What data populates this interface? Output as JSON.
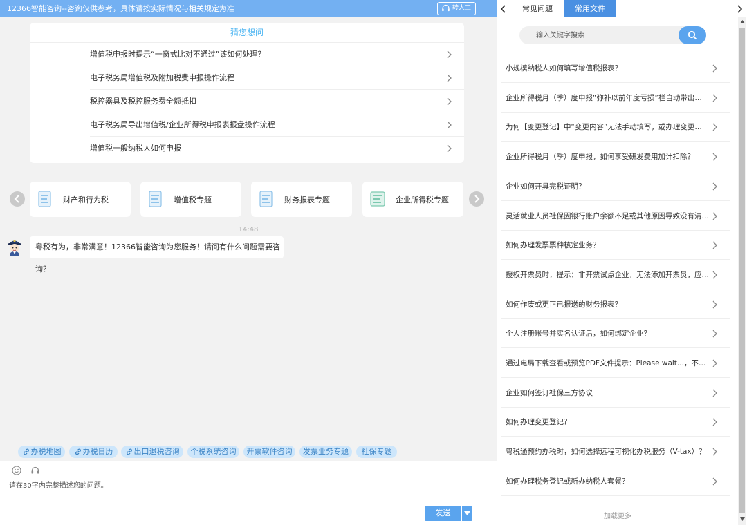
{
  "topbar": {
    "title": "12366智能咨询--咨询仅供参考，具体请按实际情况与相关规定为准",
    "human_label": "转人工"
  },
  "guess": {
    "title": "猜您想问",
    "items": [
      "增值税申报时提示“一窗式比对不通过”该如何处理？",
      "电子税务局增值税及附加税费申报操作流程",
      "税控器具及税控服务费全额抵扣",
      "电子税务局导出增值税/企业所得税申报表报盘操作流程",
      "增值税一般纳税人如何申报"
    ]
  },
  "topics": [
    "财产和行为税",
    "增值税专题",
    "财务报表专题",
    "企业所得税专题"
  ],
  "chat": {
    "time": "14:48",
    "greeting": "粤税有为，非常满意！12366智能咨询为您服务！请问有什么问题需要咨询？"
  },
  "chips": [
    "办税地图",
    "办税日历",
    "出口退税咨询",
    "个税系统咨询",
    "开票软件咨询",
    "发票业务专题",
    "社保专题"
  ],
  "input": {
    "placeholder": "请在30字内完整描述您的问题。",
    "send_label": "发送"
  },
  "right": {
    "tabs": [
      "常见问题",
      "常用文件"
    ],
    "search_placeholder": "输入关键字搜索",
    "faq": [
      "小规模纳税人如何填写增值税报表？",
      "企业所得税月（季）度申报“弥补以前年度亏损”栏自动带出，无法修改？",
      "为何【变更登记】中“变更内容”无法手动填写，或办理变更登记时提示？",
      "企业所得税月（季）度申报，如何享受研发费用加计扣除？",
      "企业如何开具完税证明？",
      "灵活就业人员社保因银行账户余额不足或其他原因导致没有清缴怎么办？",
      "如何办理发票票种核定业务？",
      "授权开票员时，提示：非开票试点企业，无法添加开票员，应如何处理？",
      "如何作废或更正已报送的财务报表？",
      "个人注册账号并实名认证后，如何绑定企业？",
      "通过电局下载查看或预览PDF文件提示：Please wait...，不能正常显示？",
      "企业如何签订社保三方协议",
      "如何办理变更登记？",
      "粤税通预约办税时，如何选择远程可视化办税服务（V-tax）？",
      "如何办理税务登记或新办纳税人套餐？"
    ],
    "load_more": "加载更多"
  },
  "colors": {
    "topbar": "#73b0f2",
    "accent": "#5aa4ee",
    "active_tab": "#4a90e2",
    "guess_title": "#4fb6f2",
    "chip_bg": "#cde6fb",
    "chip_text": "#3d85c6"
  },
  "icons": [
    "headset-icon",
    "chevron-right-icon",
    "chevron-left-icon",
    "document-icon",
    "robot-avatar",
    "link-icon",
    "emoji-icon",
    "search-icon",
    "caret-down-icon"
  ]
}
